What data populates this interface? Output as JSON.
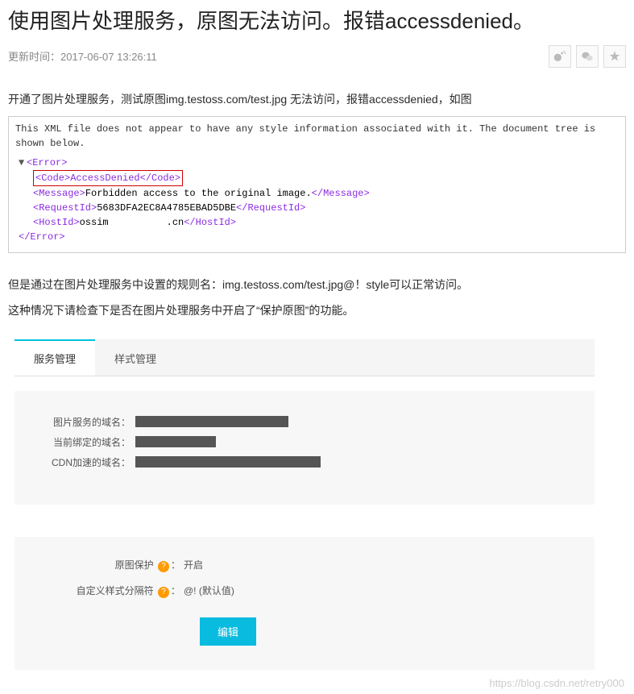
{
  "title": "使用图片处理服务，原图无法访问。报错accessdenied。",
  "update_label": "更新时间：",
  "update_time": "2017-06-07 13:26:11",
  "share": {
    "weibo": "weibo-icon",
    "wechat": "wechat-icon",
    "star": "star-icon"
  },
  "para1": "开通了图片处理服务，测试原图img.testoss.com/test.jpg 无法访问，报错accessdenied，如图",
  "xml": {
    "header": "This XML file does not appear to have any style information associated with it. The document tree is shown below.",
    "error_open": "<Error>",
    "code_line": "<Code>AccessDenied</Code>",
    "message_open": "<Message>",
    "message_text": "Forbidden access to the original image.",
    "message_close": "</Message>",
    "reqid_open": "<RequestId>",
    "reqid_text": "5683DFA2EC8A4785EBAD5DBE",
    "reqid_close": "</RequestId>",
    "hostid_open": "<HostId>",
    "hostid_text": "ossim          .cn",
    "hostid_close": "</HostId>",
    "error_close": "</Error>"
  },
  "para2": "但是通过在图片处理服务中设置的规则名：img.testoss.com/test.jpg@！style可以正常访问。",
  "para3": "这种情况下请检查下是否在图片处理服务中开启了“保护原图”的功能。",
  "tabs": {
    "service": "服务管理",
    "style": "样式管理"
  },
  "formA": {
    "label1": "图片服务的域名：",
    "label2": "当前绑定的域名：",
    "label3": "CDN加速的域名："
  },
  "formB": {
    "row1_label": "原图保护",
    "row1_value": "开启",
    "row2_label": "自定义样式分隔符",
    "row2_value": "@! (默认值)",
    "help": "?",
    "colon": "：",
    "edit": "编辑"
  },
  "watermark": "https://blog.csdn.net/retry000"
}
